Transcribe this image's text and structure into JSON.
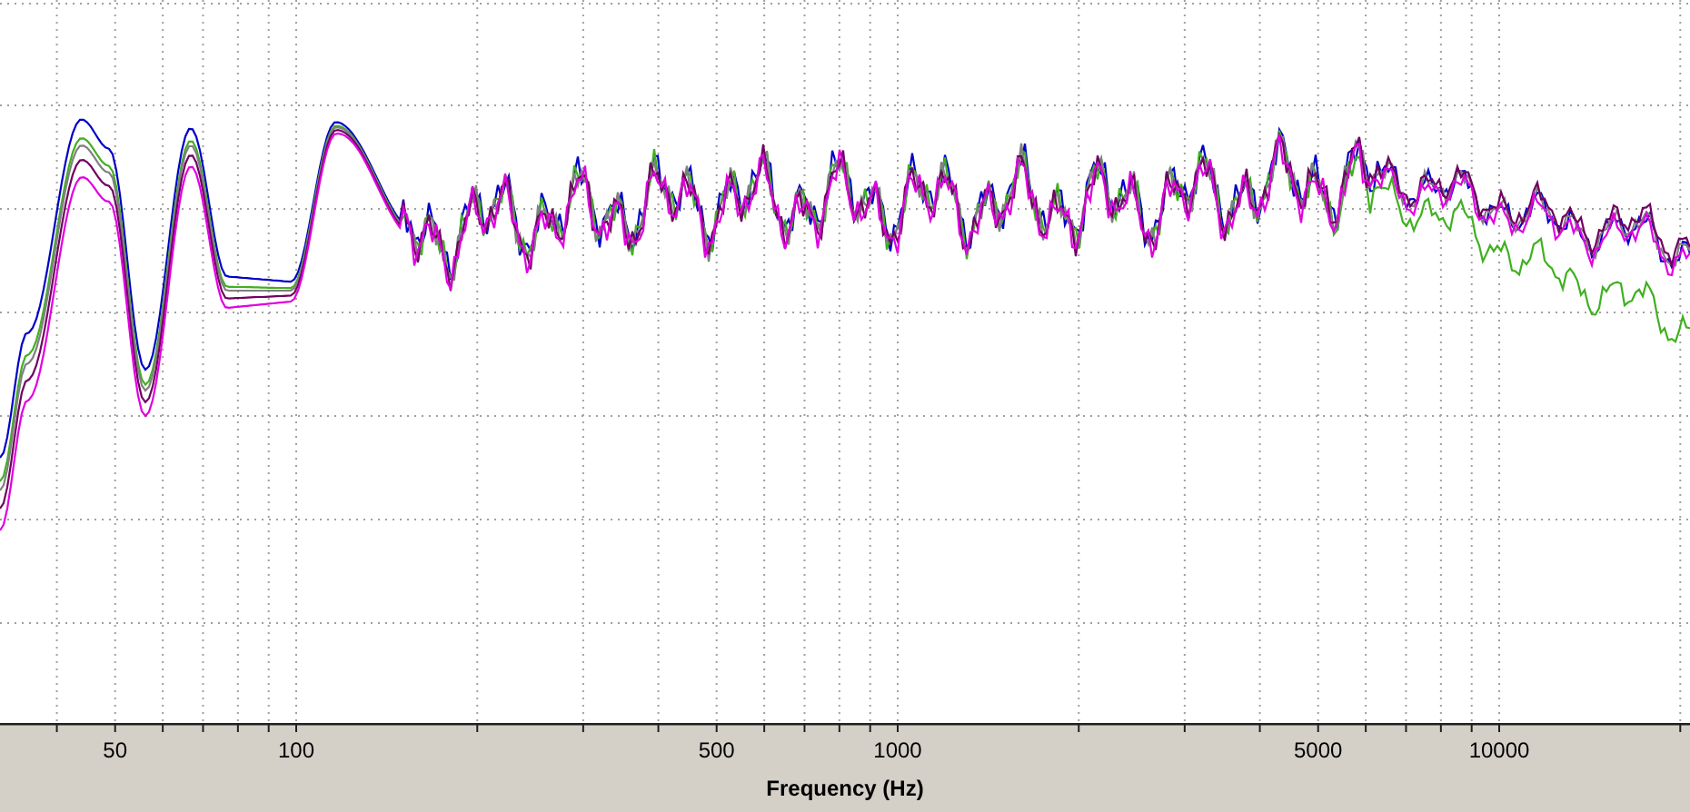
{
  "plot": {
    "curves": [
      {
        "color": "#0000c8"
      },
      {
        "color": "#40b020"
      },
      {
        "color": "#808080"
      },
      {
        "color": "#700060"
      },
      {
        "color": "#e000e0"
      }
    ],
    "x_axis": {
      "title": "Frequency (Hz)",
      "tick_labels": [
        "50",
        "100",
        "500",
        "1000",
        "5000",
        "10000"
      ]
    }
  }
}
